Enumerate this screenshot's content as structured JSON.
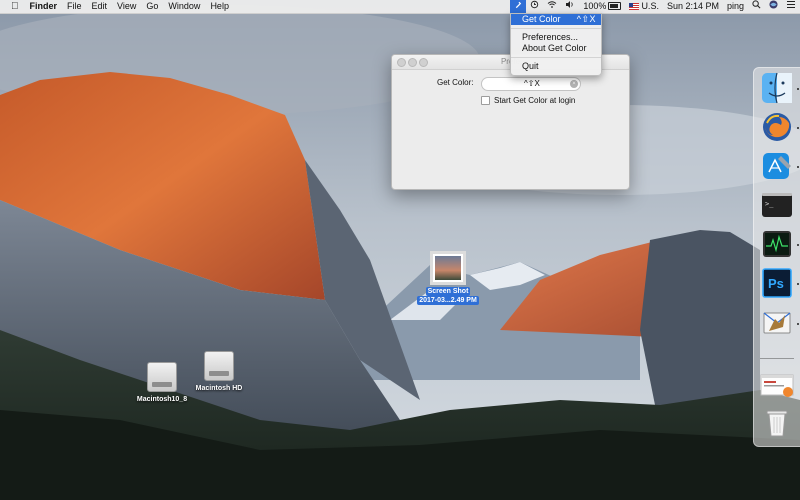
{
  "menubar": {
    "apple_icon": "apple-logo",
    "app_name": "Finder",
    "menus": [
      "File",
      "Edit",
      "View",
      "Go",
      "Window",
      "Help"
    ],
    "battery_percent": "100%",
    "input_source": "U.S.",
    "clock": "Sun 2:14 PM",
    "user": "ping"
  },
  "dropdown": {
    "get_color": {
      "label": "Get Color",
      "shortcut": "^⇧X"
    },
    "preferences": "Preferences...",
    "about": "About Get Color",
    "quit": "Quit"
  },
  "prefs_window": {
    "title": "Prefe",
    "get_color_label": "Get Color:",
    "hotkey_value": "^⇧X",
    "clear_icon": "×",
    "launch_label": "Start Get Color at login",
    "launch_checked": false
  },
  "desktop": {
    "screenshot_name_line1": "Screen Shot",
    "screenshot_name_line2": "2017-03...2.49 PM",
    "disk1": "Macintosh10_8",
    "disk2": "Macintosh HD"
  },
  "dock": {
    "apps": [
      "finder-icon",
      "firefox-icon",
      "xcode-icon",
      "terminal-icon",
      "activity-monitor-icon",
      "photoshop-icon",
      "mail-icon"
    ],
    "photoshop_text": "Ps",
    "terminal_text": ">_"
  },
  "colors": {
    "selection_blue": "#2f6fd6",
    "menubar_bg": "#ececec"
  }
}
